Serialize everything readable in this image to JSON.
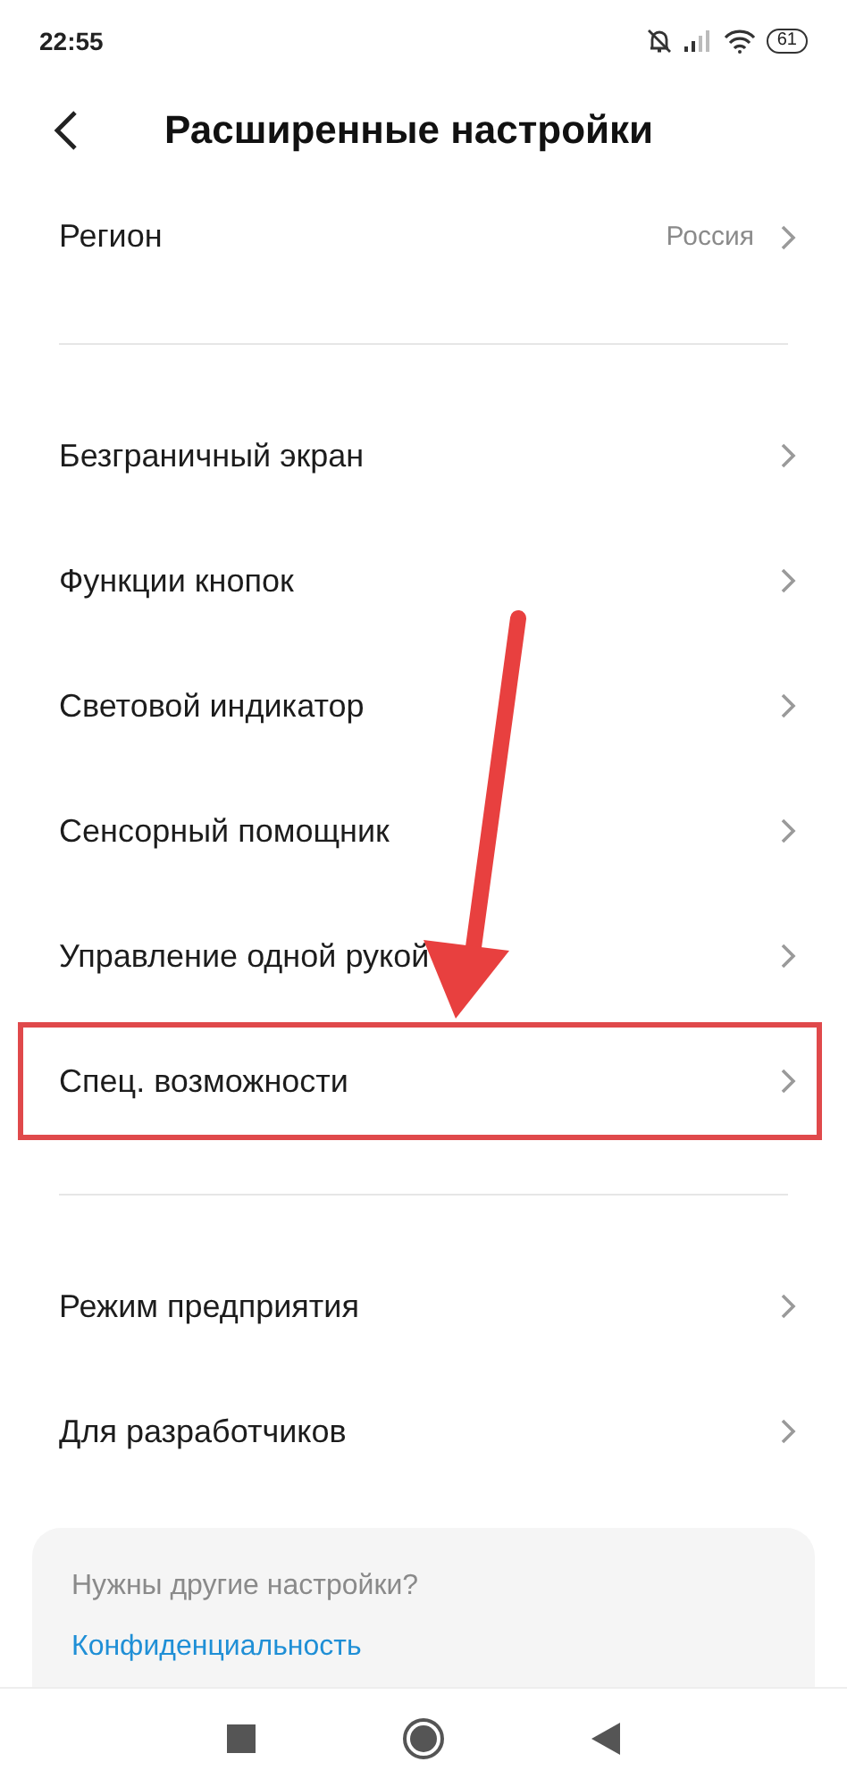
{
  "status_bar": {
    "time": "22:55",
    "battery": "61"
  },
  "header": {
    "title": "Расширенные настройки"
  },
  "sections": [
    {
      "items": [
        {
          "label": "Регион",
          "value": "Россия",
          "highlighted": false
        }
      ]
    },
    {
      "items": [
        {
          "label": "Безграничный экран",
          "highlighted": false
        },
        {
          "label": "Функции кнопок",
          "highlighted": false
        },
        {
          "label": "Световой индикатор",
          "highlighted": false
        },
        {
          "label": "Сенсорный помощник",
          "highlighted": false
        },
        {
          "label": "Управление одной рукой",
          "highlighted": false
        },
        {
          "label": "Спец. возможности",
          "highlighted": true
        }
      ]
    },
    {
      "items": [
        {
          "label": "Режим предприятия",
          "highlighted": false
        },
        {
          "label": "Для разработчиков",
          "highlighted": false
        }
      ]
    }
  ],
  "suggestion_card": {
    "title": "Нужны другие настройки?",
    "link": "Конфиденциальность"
  }
}
